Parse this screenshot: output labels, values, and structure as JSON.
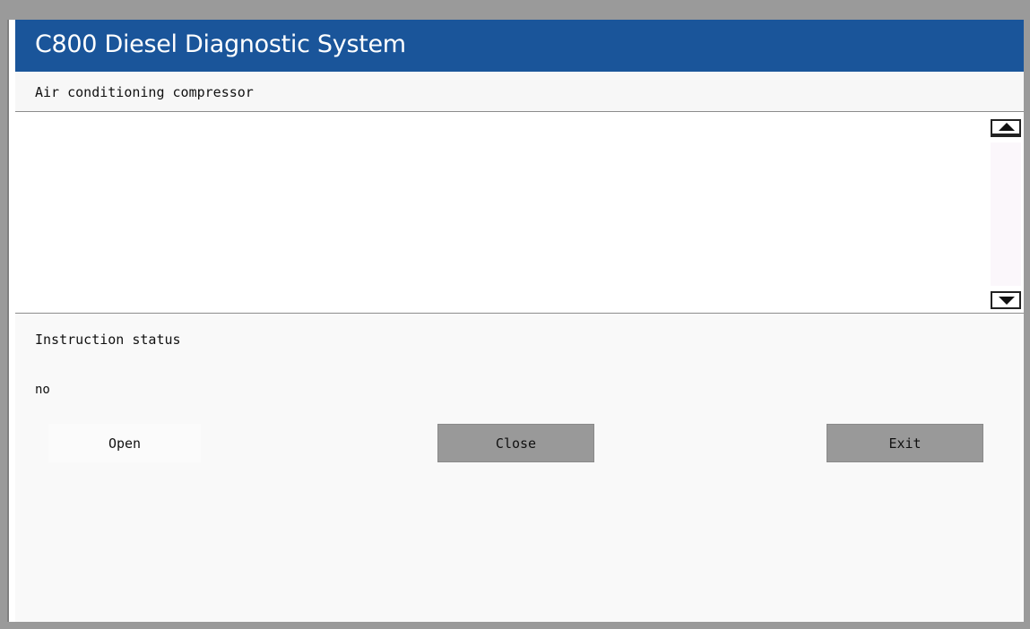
{
  "window": {
    "title": "C800 Diesel Diagnostic System"
  },
  "component": {
    "name": "Air conditioning compressor"
  },
  "list": {
    "items": []
  },
  "status": {
    "label": "Instruction status",
    "value": "no"
  },
  "buttons": {
    "open_label": "Open",
    "close_label": "Close",
    "exit_label": "Exit"
  },
  "colors": {
    "titlebar": "#1a559a",
    "button_active": "#999999"
  },
  "icons": {
    "scroll_up": "triangle-up-icon",
    "scroll_down": "triangle-down-icon"
  }
}
